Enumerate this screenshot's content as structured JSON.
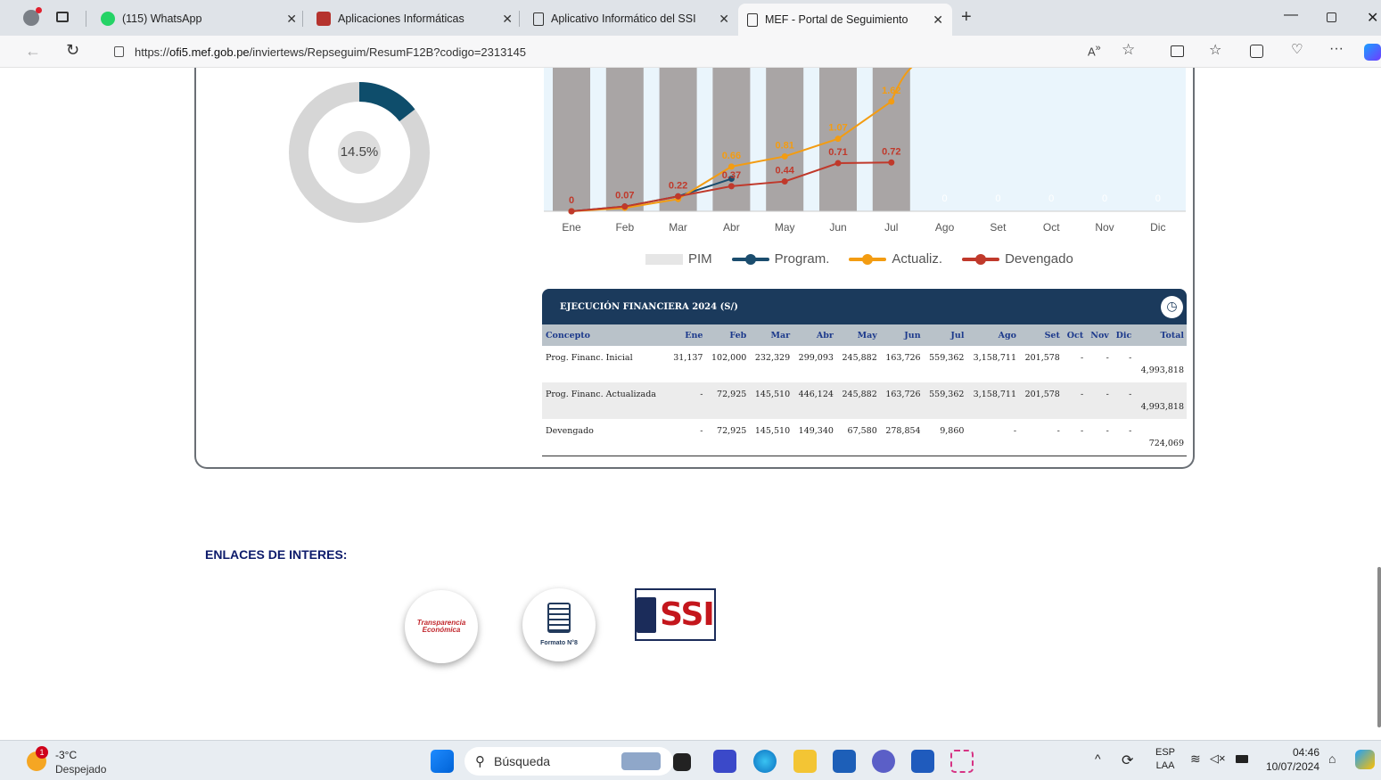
{
  "browser": {
    "tabs": [
      {
        "label": "(115) WhatsApp",
        "icon": "whatsapp-icon"
      },
      {
        "label": "Aplicaciones Informáticas",
        "icon": "crest-icon"
      },
      {
        "label": "Aplicativo Informático del SSI",
        "icon": "page-icon"
      },
      {
        "label": "MEF - Portal de Seguimiento",
        "icon": "page-icon",
        "active": true
      }
    ],
    "url_prefix": "https://",
    "url_host": "ofi5.mef.gob.pe",
    "url_path": "/inviertews/Repseguim/ResumF12B?codigo=2313145"
  },
  "donut": {
    "percent_label": "14.5%",
    "fraction": 0.145,
    "color": "#0e4d6b",
    "track": "#d6d6d6"
  },
  "chart_data": {
    "type": "bar",
    "categories": [
      "Ene",
      "Feb",
      "Mar",
      "Abr",
      "May",
      "Jun",
      "Jul",
      "Ago",
      "Set",
      "Oct",
      "Nov",
      "Dic"
    ],
    "series": [
      {
        "name": "PIM",
        "kind": "bar",
        "color": "#a9a5a5"
      },
      {
        "name": "Program.",
        "kind": "line",
        "color": "#1b4d6e",
        "values": [
          0,
          0.07,
          0.22,
          0.48,
          null,
          null,
          null
        ]
      },
      {
        "name": "Actualiz.",
        "kind": "line",
        "color": "#f39c12",
        "values": [
          0,
          0.05,
          0.18,
          0.66,
          0.81,
          1.07,
          1.62,
          null
        ],
        "labels": [
          "",
          "",
          "",
          "0.66",
          "0.81",
          "1.07",
          "1.62"
        ]
      },
      {
        "name": "Devengado",
        "kind": "line",
        "color": "#c0392b",
        "values": [
          0,
          0.07,
          0.22,
          0.37,
          0.44,
          0.71,
          0.72
        ],
        "labels": [
          "0",
          "0.07",
          "0.22",
          "0.37",
          "0.44",
          "0.71",
          "0.72"
        ]
      }
    ],
    "zero_labels": [
      "0",
      "0",
      "0",
      "0",
      "0"
    ]
  },
  "table": {
    "title": "EJECUCIÓN FINANCIERA 2024 (S/)",
    "headers": [
      "Concepto",
      "Ene",
      "Feb",
      "Mar",
      "Abr",
      "May",
      "Jun",
      "Jul",
      "Ago",
      "Set",
      "Oct",
      "Nov",
      "Dic",
      "Total"
    ],
    "rows": [
      [
        "Prog. Financ. Inicial",
        "31,137",
        "102,000",
        "232,329",
        "299,093",
        "245,882",
        "163,726",
        "559,362",
        "3,158,711",
        "201,578",
        "-",
        "-",
        "-",
        "4,993,818"
      ],
      [
        "Prog. Financ. Actualizada",
        "-",
        "72,925",
        "145,510",
        "446,124",
        "245,882",
        "163,726",
        "559,362",
        "3,158,711",
        "201,578",
        "-",
        "-",
        "-",
        "4,993,818"
      ],
      [
        "Devengado",
        "-",
        "72,925",
        "145,510",
        "149,340",
        "67,580",
        "278,854",
        "9,860",
        "-",
        "-",
        "-",
        "-",
        "-",
        "724,069"
      ]
    ]
  },
  "links": {
    "title": "ENLACES DE INTERES:",
    "transparencia_line1": "Transparencia",
    "transparencia_line2": "Económica",
    "formato_label": "Formato N°8",
    "ssi_label": "SSI"
  },
  "taskbar": {
    "weather_temp": "-3°C",
    "weather_desc": "Despejado",
    "weather_badge": "1",
    "search_placeholder": "Búsqueda",
    "lang_top": "ESP",
    "lang_bottom": "LAA",
    "time": "04:46",
    "date": "10/07/2024"
  }
}
